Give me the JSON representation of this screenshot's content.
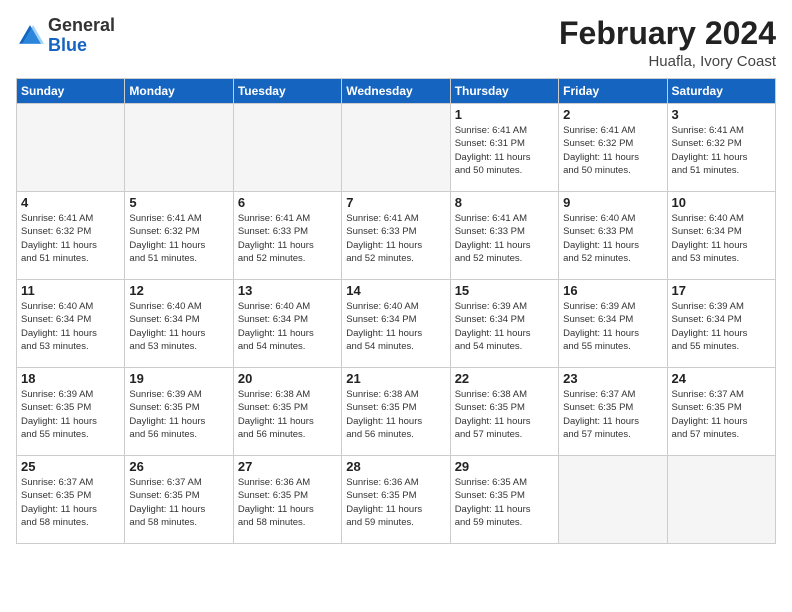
{
  "header": {
    "logo_general": "General",
    "logo_blue": "Blue",
    "month_year": "February 2024",
    "location": "Huafla, Ivory Coast"
  },
  "weekdays": [
    "Sunday",
    "Monday",
    "Tuesday",
    "Wednesday",
    "Thursday",
    "Friday",
    "Saturday"
  ],
  "weeks": [
    [
      {
        "day": "",
        "info": "",
        "empty": true
      },
      {
        "day": "",
        "info": "",
        "empty": true
      },
      {
        "day": "",
        "info": "",
        "empty": true
      },
      {
        "day": "",
        "info": "",
        "empty": true
      },
      {
        "day": "1",
        "info": "Sunrise: 6:41 AM\nSunset: 6:31 PM\nDaylight: 11 hours\nand 50 minutes.",
        "empty": false
      },
      {
        "day": "2",
        "info": "Sunrise: 6:41 AM\nSunset: 6:32 PM\nDaylight: 11 hours\nand 50 minutes.",
        "empty": false
      },
      {
        "day": "3",
        "info": "Sunrise: 6:41 AM\nSunset: 6:32 PM\nDaylight: 11 hours\nand 51 minutes.",
        "empty": false
      }
    ],
    [
      {
        "day": "4",
        "info": "Sunrise: 6:41 AM\nSunset: 6:32 PM\nDaylight: 11 hours\nand 51 minutes.",
        "empty": false
      },
      {
        "day": "5",
        "info": "Sunrise: 6:41 AM\nSunset: 6:32 PM\nDaylight: 11 hours\nand 51 minutes.",
        "empty": false
      },
      {
        "day": "6",
        "info": "Sunrise: 6:41 AM\nSunset: 6:33 PM\nDaylight: 11 hours\nand 52 minutes.",
        "empty": false
      },
      {
        "day": "7",
        "info": "Sunrise: 6:41 AM\nSunset: 6:33 PM\nDaylight: 11 hours\nand 52 minutes.",
        "empty": false
      },
      {
        "day": "8",
        "info": "Sunrise: 6:41 AM\nSunset: 6:33 PM\nDaylight: 11 hours\nand 52 minutes.",
        "empty": false
      },
      {
        "day": "9",
        "info": "Sunrise: 6:40 AM\nSunset: 6:33 PM\nDaylight: 11 hours\nand 52 minutes.",
        "empty": false
      },
      {
        "day": "10",
        "info": "Sunrise: 6:40 AM\nSunset: 6:34 PM\nDaylight: 11 hours\nand 53 minutes.",
        "empty": false
      }
    ],
    [
      {
        "day": "11",
        "info": "Sunrise: 6:40 AM\nSunset: 6:34 PM\nDaylight: 11 hours\nand 53 minutes.",
        "empty": false
      },
      {
        "day": "12",
        "info": "Sunrise: 6:40 AM\nSunset: 6:34 PM\nDaylight: 11 hours\nand 53 minutes.",
        "empty": false
      },
      {
        "day": "13",
        "info": "Sunrise: 6:40 AM\nSunset: 6:34 PM\nDaylight: 11 hours\nand 54 minutes.",
        "empty": false
      },
      {
        "day": "14",
        "info": "Sunrise: 6:40 AM\nSunset: 6:34 PM\nDaylight: 11 hours\nand 54 minutes.",
        "empty": false
      },
      {
        "day": "15",
        "info": "Sunrise: 6:39 AM\nSunset: 6:34 PM\nDaylight: 11 hours\nand 54 minutes.",
        "empty": false
      },
      {
        "day": "16",
        "info": "Sunrise: 6:39 AM\nSunset: 6:34 PM\nDaylight: 11 hours\nand 55 minutes.",
        "empty": false
      },
      {
        "day": "17",
        "info": "Sunrise: 6:39 AM\nSunset: 6:34 PM\nDaylight: 11 hours\nand 55 minutes.",
        "empty": false
      }
    ],
    [
      {
        "day": "18",
        "info": "Sunrise: 6:39 AM\nSunset: 6:35 PM\nDaylight: 11 hours\nand 55 minutes.",
        "empty": false
      },
      {
        "day": "19",
        "info": "Sunrise: 6:39 AM\nSunset: 6:35 PM\nDaylight: 11 hours\nand 56 minutes.",
        "empty": false
      },
      {
        "day": "20",
        "info": "Sunrise: 6:38 AM\nSunset: 6:35 PM\nDaylight: 11 hours\nand 56 minutes.",
        "empty": false
      },
      {
        "day": "21",
        "info": "Sunrise: 6:38 AM\nSunset: 6:35 PM\nDaylight: 11 hours\nand 56 minutes.",
        "empty": false
      },
      {
        "day": "22",
        "info": "Sunrise: 6:38 AM\nSunset: 6:35 PM\nDaylight: 11 hours\nand 57 minutes.",
        "empty": false
      },
      {
        "day": "23",
        "info": "Sunrise: 6:37 AM\nSunset: 6:35 PM\nDaylight: 11 hours\nand 57 minutes.",
        "empty": false
      },
      {
        "day": "24",
        "info": "Sunrise: 6:37 AM\nSunset: 6:35 PM\nDaylight: 11 hours\nand 57 minutes.",
        "empty": false
      }
    ],
    [
      {
        "day": "25",
        "info": "Sunrise: 6:37 AM\nSunset: 6:35 PM\nDaylight: 11 hours\nand 58 minutes.",
        "empty": false
      },
      {
        "day": "26",
        "info": "Sunrise: 6:37 AM\nSunset: 6:35 PM\nDaylight: 11 hours\nand 58 minutes.",
        "empty": false
      },
      {
        "day": "27",
        "info": "Sunrise: 6:36 AM\nSunset: 6:35 PM\nDaylight: 11 hours\nand 58 minutes.",
        "empty": false
      },
      {
        "day": "28",
        "info": "Sunrise: 6:36 AM\nSunset: 6:35 PM\nDaylight: 11 hours\nand 59 minutes.",
        "empty": false
      },
      {
        "day": "29",
        "info": "Sunrise: 6:35 AM\nSunset: 6:35 PM\nDaylight: 11 hours\nand 59 minutes.",
        "empty": false
      },
      {
        "day": "",
        "info": "",
        "empty": true
      },
      {
        "day": "",
        "info": "",
        "empty": true
      }
    ]
  ]
}
